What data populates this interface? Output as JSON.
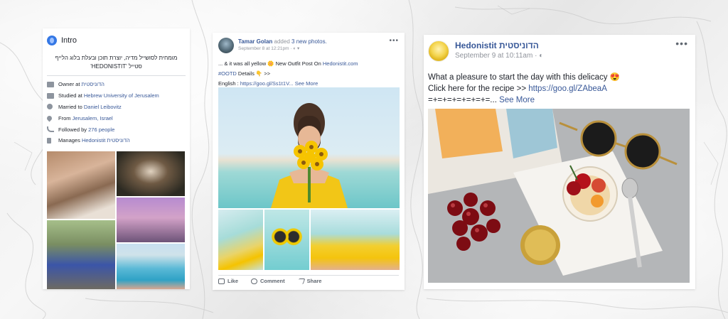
{
  "intro": {
    "title": "Intro",
    "bio": "מומחית לסושייל מדיה, יוצרת תוכן ובעלת בלוג הלייף סטייל 'HEDONISTIT'",
    "rows": [
      {
        "icon": "briefcase-icon",
        "prefix": "Owner at ",
        "link": "הדוניסטית"
      },
      {
        "icon": "graduation-cap-icon",
        "prefix": "Studied at ",
        "link": "Hebrew University of Jerusalem"
      },
      {
        "icon": "heart-icon",
        "prefix": "Married to ",
        "link": "Daniel Leibovitz"
      },
      {
        "icon": "location-pin-icon",
        "prefix": "From ",
        "link": "Jerusalem, Israel"
      },
      {
        "icon": "rss-icon",
        "prefix": "Followed by ",
        "link": "276 people"
      },
      {
        "icon": "flag-icon",
        "prefix": "Manages ",
        "link": "Hedonistit הדוניסטית"
      }
    ]
  },
  "post2": {
    "author": "Tamar Golan",
    "action": " added ",
    "action_link": "3 new photos.",
    "meta": "September 8 at 12:21pm · ◐ ▾",
    "line1": "... & it was all yellow 🌼  New Outfit Post On ",
    "line1_link": "Hedonistit.com",
    "line2_link": "#OOTD",
    "line2": " Details 👇  >>",
    "line3": "English : ",
    "line3_link": "https://goo.gl/Ss1t1V...",
    "line3_more": " See More",
    "like": "Like",
    "comment": "Comment",
    "share": "Share"
  },
  "post3": {
    "author": "Hedonistit הדוניסטית",
    "meta": "September 9 at 10:11am · ◐",
    "line1": "What a pleasure to start the day with this delicacy 😍",
    "line2": "Click here for the recipe >> ",
    "line2_link": "https://goo.gl/ZAbeaA",
    "line3": "=+=+=+=+=+=+=...",
    "line3_more": " See More"
  },
  "colors": {
    "link": "#385898",
    "accent_blue": "#3578e5",
    "text": "#1d2129",
    "muted": "#90949c"
  }
}
